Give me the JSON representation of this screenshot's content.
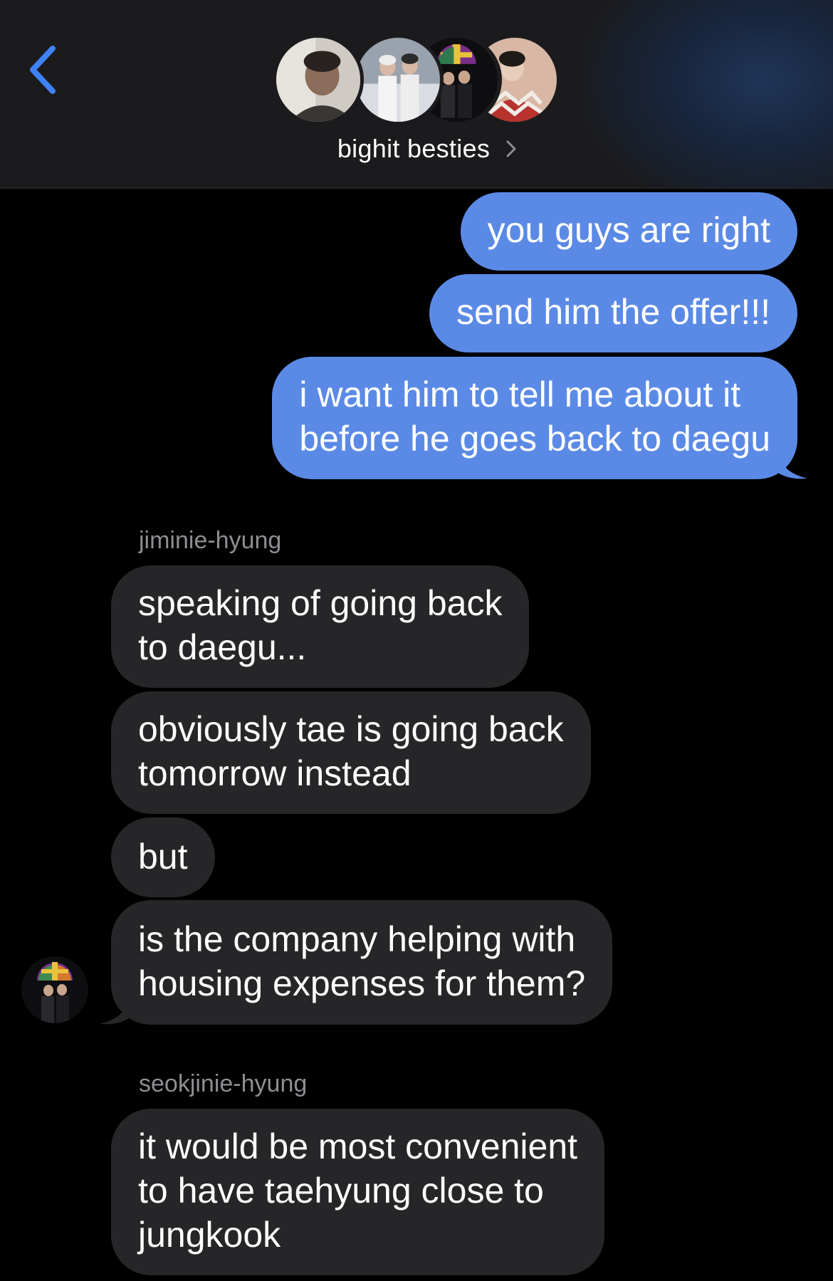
{
  "header": {
    "group_name": "bighit besties",
    "back_icon": "chevron-left-icon",
    "disclosure_icon": "chevron-right-icon"
  },
  "messages": {
    "outgoing": [
      "you guys are right",
      "send him the offer!!!",
      "i want him to tell me about it\nbefore he goes back to daegu"
    ],
    "jimin": {
      "sender": "jiminie-hyung",
      "texts": [
        "speaking of going back\nto daegu...",
        "obviously tae is going back\ntomorrow instead",
        "but",
        "is the company helping with\nhousing expenses for them?"
      ]
    },
    "seokjin": {
      "sender": "seokjinie-hyung",
      "texts": [
        "it would be most convenient\nto have taehyung close to\njungkook"
      ]
    }
  },
  "colors": {
    "outgoing_bubble": "#5b8ae6",
    "incoming_bubble": "#262628",
    "accent_blue": "#3f82f7",
    "sender_name": "#8e8e93"
  }
}
